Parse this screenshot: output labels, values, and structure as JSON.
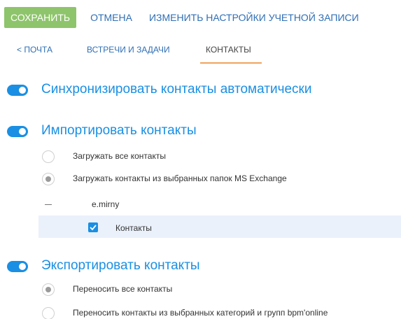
{
  "toolbar": {
    "save_label": "СОХРАНИТЬ",
    "cancel_label": "ОТМЕНА",
    "account_settings_label": "ИЗМЕНИТЬ НАСТРОЙКИ УЧЕТНОЙ ЗАПИСИ"
  },
  "tabs": {
    "back_label": "< ПОЧТА",
    "meetings_label": "ВСТРЕЧИ И ЗАДАЧИ",
    "contacts_label": "КОНТАКТЫ",
    "active": "КОНТАКТЫ"
  },
  "sync": {
    "label": "Синхронизировать контакты автоматически",
    "enabled": true
  },
  "import": {
    "label": "Импортировать контакты",
    "enabled": true,
    "options": [
      {
        "label": "Загружать все контакты",
        "checked": false
      },
      {
        "label": "Загружать контакты из выбранных папок MS Exchange",
        "checked": true
      }
    ],
    "folder": {
      "name": "e.mirny",
      "children": [
        {
          "label": "Контакты",
          "checked": true
        }
      ]
    }
  },
  "export": {
    "label": "Экспортировать контакты",
    "enabled": true,
    "options": [
      {
        "label": "Переносить все контакты",
        "checked": true
      },
      {
        "label": "Переносить контакты из выбранных категорий и групп bpm'online",
        "checked": false
      }
    ]
  },
  "colors": {
    "accent": "#1a8fe3",
    "save_button": "#8ec46b",
    "link": "#2f6fb5",
    "active_tab_underline": "#f0a35c",
    "selected_row": "#eaf1fb"
  }
}
